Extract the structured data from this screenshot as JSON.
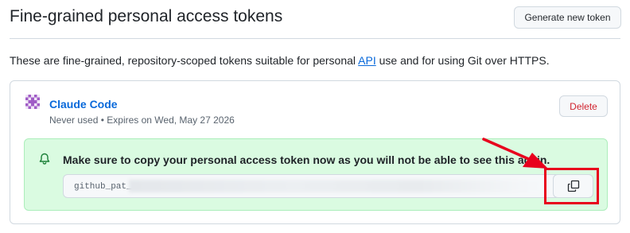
{
  "header": {
    "title": "Fine-grained personal access tokens",
    "generate_label": "Generate new token"
  },
  "description": {
    "before": "These are fine-grained, repository-scoped tokens suitable for personal ",
    "link": "API",
    "after": " use and for using Git over HTTPS."
  },
  "token": {
    "name": "Claude Code",
    "usage": "Never used",
    "separator": "•",
    "expires": "Expires on Wed, May 27 2026",
    "delete_label": "Delete",
    "notice": "Make sure to copy your personal access token now as you will not be able to see this again.",
    "value_prefix": "github_pat_"
  },
  "icons": {
    "avatar": "identicon-avatar",
    "notice": "bell-icon",
    "copy": "copy-icon"
  },
  "annotation": {
    "color": "#e8001d",
    "target": "copy-button"
  },
  "colors": {
    "link": "#0969da",
    "danger": "#d1242f",
    "success_bg": "#dafbe1",
    "success_border": "#aceebb"
  }
}
